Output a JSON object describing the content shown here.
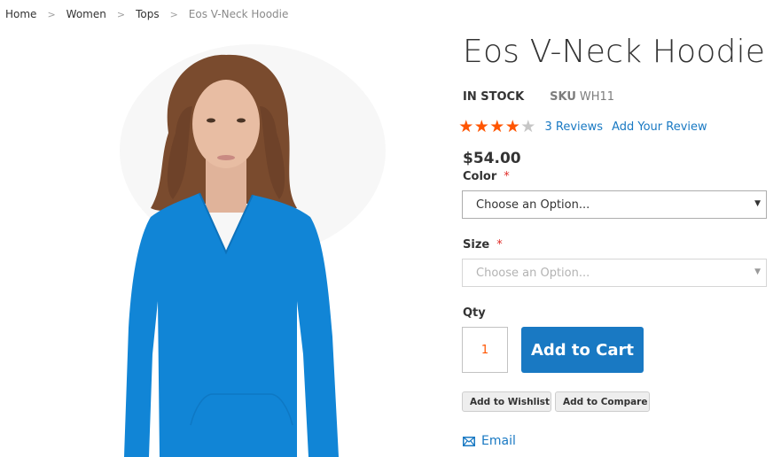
{
  "breadcrumb": [
    {
      "label": "Home"
    },
    {
      "label": "Women"
    },
    {
      "label": "Tops"
    },
    {
      "label": "Eos V-Neck Hoodie"
    }
  ],
  "breadcrumb_separator": ">",
  "product": {
    "title": "Eos V-Neck Hoodie",
    "stock_status": "IN STOCK",
    "sku_label": "SKU",
    "sku": "WH11",
    "rating": {
      "value": 4,
      "max": 5,
      "reviews_label": "3 Reviews",
      "add_review_label": "Add Your Review"
    },
    "price": "$54.00",
    "image_alt": "Woman wearing blue V-neck hoodie",
    "hoodie_color": "#1185d6"
  },
  "options": {
    "color": {
      "label": "Color",
      "required_mark": "*",
      "selected": "Choose an Option..."
    },
    "size": {
      "label": "Size",
      "required_mark": "*",
      "selected": "Choose an Option..."
    }
  },
  "qty": {
    "label": "Qty",
    "value": "1"
  },
  "actions": {
    "add_to_cart": "Add to Cart",
    "add_to_wishlist": "Add to Wishlist",
    "add_to_compare": "Add to Compare",
    "email": "Email"
  },
  "colors": {
    "accent": "#1979c3",
    "star": "#ff5501",
    "required": "#e02b27"
  }
}
